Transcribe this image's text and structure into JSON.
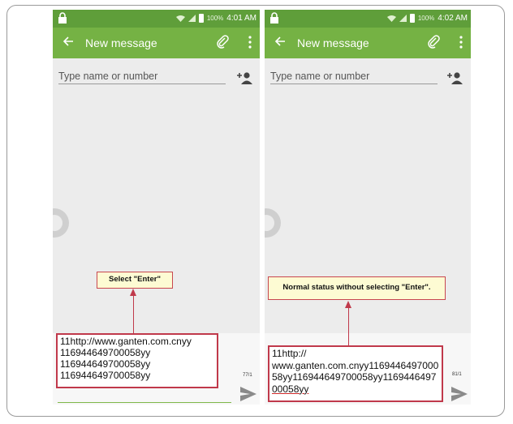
{
  "left_screen": {
    "status_bar": {
      "battery": "100%",
      "time": "4:01 AM"
    },
    "app_bar": {
      "title": "New message"
    },
    "recipient_placeholder": "Type name or number",
    "message_lines": [
      "11http://www.ganten.com.cnyy",
      "116944649700058yy",
      "116944649700058yy",
      "116944649700058yy"
    ],
    "char_counter": "77/1",
    "annotation": "Select \"Enter\""
  },
  "right_screen": {
    "status_bar": {
      "battery": "100%",
      "time": "4:02 AM"
    },
    "app_bar": {
      "title": "New message"
    },
    "recipient_placeholder": "Type name or number",
    "message_lines": [
      "11http://",
      "www.ganten.com.cnyy1169446497000",
      "58yy116944649700058yy1169446497",
      "00058yy"
    ],
    "char_counter": "81/1",
    "annotation": "Normal status without selecting \"Enter\"."
  },
  "colors": {
    "status_bar": "#5f9e3a",
    "app_bar": "#75b244",
    "annotation_border": "#c0394b",
    "annotation_fill": "#fdfbd3",
    "screen_bg": "#ececec"
  },
  "icons": [
    "lock-icon",
    "wifi-icon",
    "signal-icon",
    "battery-icon",
    "back-arrow-icon",
    "paperclip-icon",
    "more-vert-icon",
    "add-contact-icon",
    "send-icon"
  ]
}
